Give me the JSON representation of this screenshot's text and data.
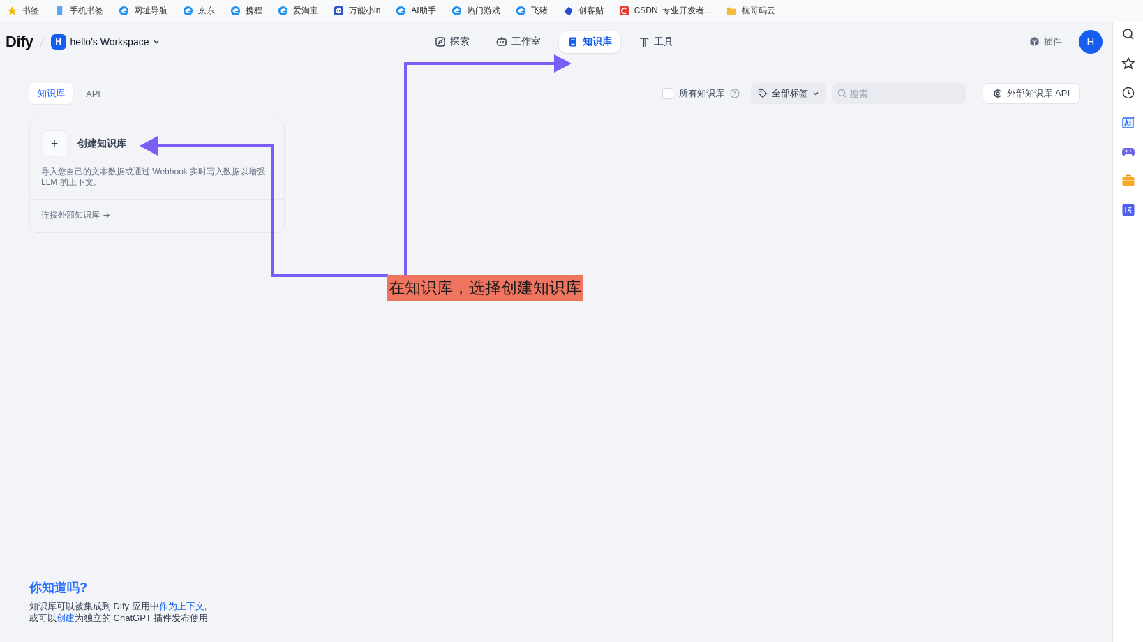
{
  "bookmarks": [
    {
      "label": "书签"
    },
    {
      "label": "手机书签"
    },
    {
      "label": "网址导航"
    },
    {
      "label": "京东"
    },
    {
      "label": "携程"
    },
    {
      "label": "爱淘宝"
    },
    {
      "label": "万能小in"
    },
    {
      "label": "AI助手"
    },
    {
      "label": "热门游戏"
    },
    {
      "label": "飞猪"
    },
    {
      "label": "创客贴"
    },
    {
      "label": "CSDN_专业开发者..."
    },
    {
      "label": "杭哥码云"
    }
  ],
  "header": {
    "logo": "Dify",
    "workspace": {
      "avatar": "H",
      "name": "hello's Workspace"
    },
    "nav": [
      {
        "label": "探索",
        "selected": false
      },
      {
        "label": "工作室",
        "selected": false
      },
      {
        "label": "知识库",
        "selected": true
      },
      {
        "label": "工具",
        "selected": false
      }
    ],
    "plugins": "插件",
    "user_avatar": "H"
  },
  "tabs": [
    {
      "label": "知识库",
      "selected": true
    },
    {
      "label": "API",
      "selected": false
    }
  ],
  "filters": {
    "all_datasets": {
      "label": "所有知识库",
      "checked": false
    },
    "tags": "全部标签",
    "search": {
      "placeholder": "搜索"
    },
    "external_api": "外部知识库 API"
  },
  "create_card": {
    "plus": "+",
    "title": "创建知识库",
    "description": "导入您自己的文本数据或通过 Webhook 实时写入数据以增强 LLM 的上下文。",
    "link": "连接外部知识库"
  },
  "annotation": {
    "label": "在知识库，选择创建知识库"
  },
  "tip": {
    "title": "你知道吗?",
    "lines": [
      [
        {
          "kind": "text",
          "text": "知识库可以被集成到 Dify 应用中"
        },
        {
          "kind": "link",
          "text": "作为上下文"
        },
        {
          "kind": "text",
          "text": ","
        }
      ],
      [
        {
          "kind": "text",
          "text": "或可以"
        },
        {
          "kind": "link",
          "text": "创建"
        },
        {
          "kind": "text",
          "text": "为独立的 ChatGPT 插件发布使用"
        }
      ]
    ]
  }
}
